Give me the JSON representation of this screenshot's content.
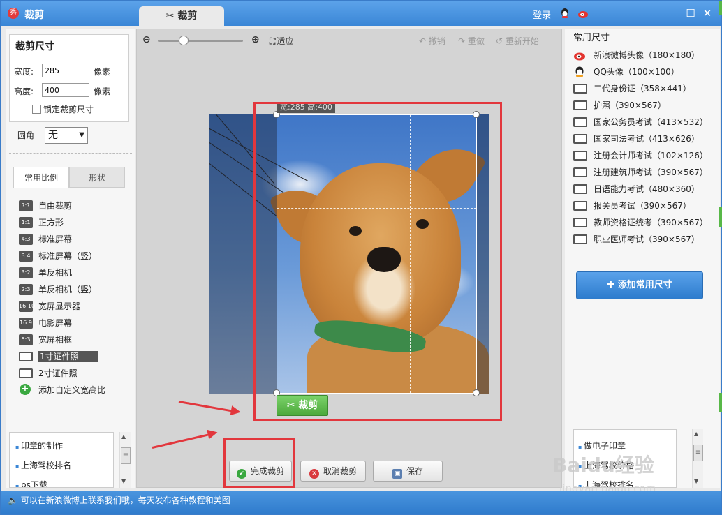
{
  "app": {
    "logo": "秀",
    "title": "裁剪",
    "active_tab": "裁剪",
    "login": "登录"
  },
  "crop_size": {
    "heading": "裁剪尺寸",
    "width_label": "宽度:",
    "width_value": "285",
    "width_unit": "像素",
    "height_label": "高度:",
    "height_value": "400",
    "height_unit": "像素",
    "lock_label": "锁定裁剪尺寸",
    "round_label": "圆角",
    "round_value": "无"
  },
  "left_tabs": [
    "常用比例",
    "形状"
  ],
  "ratios": [
    {
      "badge": "?:?",
      "label": "自由裁剪"
    },
    {
      "badge": "1:1",
      "label": "正方形"
    },
    {
      "badge": "4:3",
      "label": "标准屏幕"
    },
    {
      "badge": "3:4",
      "label": "标准屏幕（竖）"
    },
    {
      "badge": "3:2",
      "label": "单反相机"
    },
    {
      "badge": "2:3",
      "label": "单反相机（竖）"
    },
    {
      "badge": "16:10",
      "label": "宽屏显示器"
    },
    {
      "badge": "16:9",
      "label": "电影屏幕"
    },
    {
      "badge": "5:3",
      "label": "宽屏相框"
    },
    {
      "badge": "id",
      "label": "1寸证件照",
      "selected": true
    },
    {
      "badge": "id",
      "label": "2寸证件照"
    },
    {
      "badge": "+",
      "label": "添加自定义宽高比"
    }
  ],
  "left_links": [
    "印章的制作",
    "上海驾校排名",
    "ps下载"
  ],
  "toolbar": {
    "fit": "适应",
    "undo": "撤销",
    "redo": "重做",
    "restart": "重新开始"
  },
  "crop": {
    "dim_label": "宽:285 高:400",
    "crop_button": "裁剪"
  },
  "bottom_buttons": {
    "done": "完成裁剪",
    "cancel": "取消裁剪",
    "save": "保存"
  },
  "right": {
    "heading": "常用尺寸",
    "presets": [
      {
        "icon": "weibo-icon",
        "label": "新浪微博头像（180×180）"
      },
      {
        "icon": "qq-icon",
        "label": "QQ头像（100×100）"
      },
      {
        "icon": "id-card-icon",
        "label": "二代身份证（358×441）"
      },
      {
        "icon": "id-card-icon",
        "label": "护照（390×567）"
      },
      {
        "icon": "id-card-icon",
        "label": "国家公务员考试（413×532）"
      },
      {
        "icon": "id-card-icon",
        "label": "国家司法考试（413×626）"
      },
      {
        "icon": "id-card-icon",
        "label": "注册会计师考试（102×126）"
      },
      {
        "icon": "id-card-icon",
        "label": "注册建筑师考试（390×567）"
      },
      {
        "icon": "id-card-icon",
        "label": "日语能力考试（480×360）"
      },
      {
        "icon": "id-card-icon",
        "label": "报关员考试（390×567）"
      },
      {
        "icon": "id-card-icon",
        "label": "教师资格证统考（390×567）"
      },
      {
        "icon": "id-card-icon",
        "label": "职业医师考试（390×567）"
      }
    ],
    "add_button": "添加常用尺寸",
    "links": [
      "做电子印章",
      "上海驾校价格",
      "上海驾校排名"
    ]
  },
  "status": "可以在新浪微博上联系我们哦，每天发布各种教程和美图",
  "watermark": {
    "brand": "Baidu经验",
    "url": "jingyan.baidu.com"
  }
}
